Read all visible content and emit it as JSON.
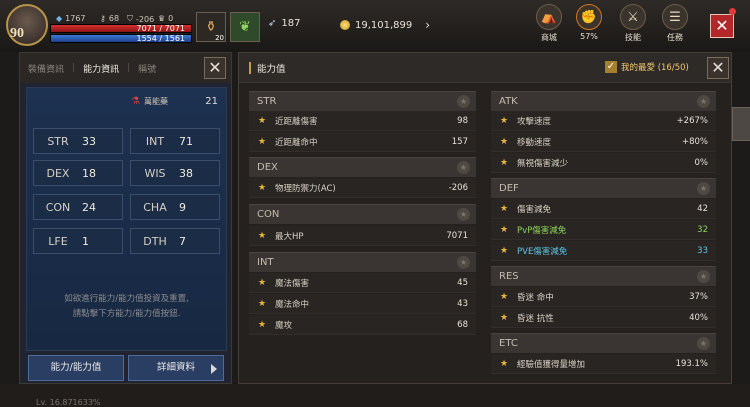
{
  "hud": {
    "level": "90",
    "stat_a": "1767",
    "stat_b": "68",
    "stat_c": "-206",
    "stat_d": "0",
    "hp": "7071 / 7071",
    "mp": "1554 / 1561",
    "item_count": "20",
    "gems": "187",
    "gold": "19,101,899",
    "menu": [
      {
        "label": "商城",
        "icon": "shop-icon"
      },
      {
        "label": "57%",
        "icon": "quest-progress-icon"
      },
      {
        "label": "技能",
        "icon": "skill-icon"
      },
      {
        "label": "任務",
        "icon": "quest-icon"
      }
    ]
  },
  "left_panel": {
    "tabs": [
      "裝備資訊",
      "能力資訊",
      "稱號"
    ],
    "active_tab": 1,
    "potion": {
      "name": "萬能藥",
      "value": "21"
    },
    "stats": [
      {
        "key": "STR",
        "value": "33"
      },
      {
        "key": "INT",
        "value": "71"
      },
      {
        "key": "DEX",
        "value": "18"
      },
      {
        "key": "WIS",
        "value": "38"
      },
      {
        "key": "CON",
        "value": "24"
      },
      {
        "key": "CHA",
        "value": "9"
      },
      {
        "key": "LFE",
        "value": "1"
      },
      {
        "key": "DTH",
        "value": "7"
      }
    ],
    "hint_line1": "如欲進行能力/能力值投資及重置,",
    "hint_line2": "請點擊下方能力/能力值按鈕.",
    "btn_ability": "能力/能力值",
    "btn_detail": "詳細資料"
  },
  "right_panel": {
    "title": "能力值",
    "favorites": "我的最愛 (16/50)",
    "left_column": [
      {
        "name": "STR",
        "rows": [
          {
            "label": "近距離傷害",
            "value": "98"
          },
          {
            "label": "近距離命中",
            "value": "157"
          }
        ]
      },
      {
        "name": "DEX",
        "rows": [
          {
            "label": "物理防禦力(AC)",
            "value": "-206"
          }
        ]
      },
      {
        "name": "CON",
        "rows": [
          {
            "label": "最大HP",
            "value": "7071"
          }
        ]
      },
      {
        "name": "INT",
        "rows": [
          {
            "label": "魔法傷害",
            "value": "45"
          },
          {
            "label": "魔法命中",
            "value": "43"
          },
          {
            "label": "魔攻",
            "value": "68"
          }
        ]
      }
    ],
    "right_column": [
      {
        "name": "ATK",
        "rows": [
          {
            "label": "攻擊速度",
            "value": "+267%"
          },
          {
            "label": "移動速度",
            "value": "+80%"
          },
          {
            "label": "無視傷害減少",
            "value": "0%"
          }
        ]
      },
      {
        "name": "DEF",
        "rows": [
          {
            "label": "傷害減免",
            "value": "42"
          },
          {
            "label": "PvP傷害減免",
            "value": "32"
          },
          {
            "label": "PVE傷害減免",
            "value": "33"
          }
        ]
      },
      {
        "name": "RES",
        "rows": [
          {
            "label": "昏迷 命中",
            "value": "37%"
          },
          {
            "label": "昏迷 抗性",
            "value": "40%"
          }
        ]
      },
      {
        "name": "ETC",
        "rows": [
          {
            "label": "經驗值獲得量增加",
            "value": "193.1%"
          }
        ]
      }
    ]
  },
  "colors": {
    "accent": "#c69a4c",
    "star": "#e8b43b",
    "pvp": "#8fd45c",
    "pve": "#5fc6e4",
    "close": "#b3262a"
  },
  "footer": "Lv. 16.871633%"
}
